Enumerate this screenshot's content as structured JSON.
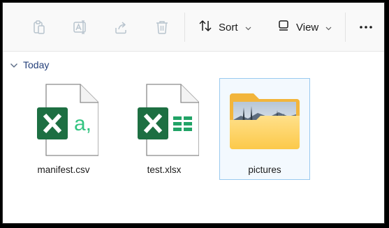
{
  "toolbar": {
    "buttons": [
      {
        "icon": "copy-icon",
        "label": "Copy"
      },
      {
        "icon": "rename-icon",
        "label": "Rename"
      },
      {
        "icon": "share-icon",
        "label": "Share"
      },
      {
        "icon": "delete-icon",
        "label": "Delete"
      }
    ],
    "sort_label": "Sort",
    "view_label": "View",
    "more_icon": "more-options-icon"
  },
  "group": {
    "title": "Today",
    "expanded": true
  },
  "files": [
    {
      "name": "manifest.csv",
      "type": "csv",
      "icon": "excel-csv-icon"
    },
    {
      "name": "test.xlsx",
      "type": "xlsx",
      "icon": "excel-icon"
    },
    {
      "name": "pictures",
      "type": "folder",
      "icon": "folder-icon",
      "selected": true
    }
  ],
  "colors": {
    "excel_green": "#1d6f42",
    "excel_accent": "#33c481",
    "folder_yellow": "#ffd25c",
    "selection_border": "#99c9ef",
    "group_header": "#24407a"
  }
}
